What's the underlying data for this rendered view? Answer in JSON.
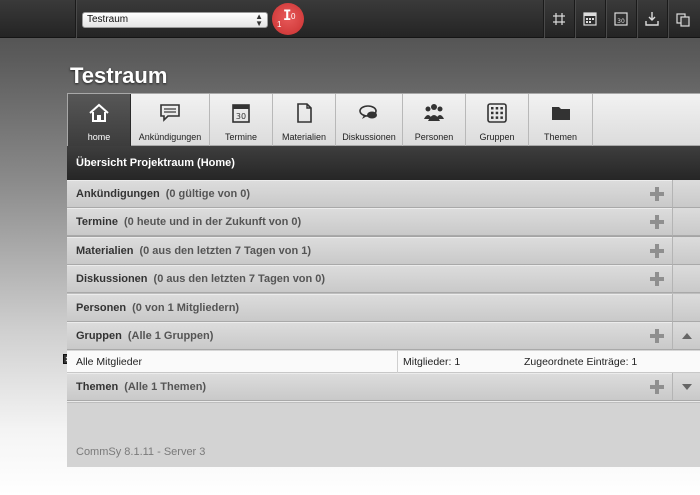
{
  "topbar": {
    "room_select_value": "Testraum",
    "icons": [
      "grid-icon",
      "calendar-list-icon",
      "calendar-30-icon",
      "download-icon",
      "copy-icon"
    ]
  },
  "room": {
    "title": "Testraum"
  },
  "tabs": [
    {
      "label": "home",
      "icon": "home-icon",
      "active": true
    },
    {
      "label": "Ankündigungen",
      "icon": "announcement-icon"
    },
    {
      "label": "Termine",
      "icon": "calendar-icon"
    },
    {
      "label": "Materialien",
      "icon": "document-icon"
    },
    {
      "label": "Diskussionen",
      "icon": "discussion-icon"
    },
    {
      "label": "Personen",
      "icon": "people-icon"
    },
    {
      "label": "Gruppen",
      "icon": "groups-icon"
    },
    {
      "label": "Themen",
      "icon": "folder-icon"
    }
  ],
  "overview": {
    "title": "Übersicht Projektraum (Home)"
  },
  "sections": [
    {
      "name": "Ankündigungen",
      "info": "(0 gültige von 0)"
    },
    {
      "name": "Termine",
      "info": "(0 heute und in der Zukunft von 0)"
    },
    {
      "name": "Materialien",
      "info": "(0 aus den letzten 7 Tagen von 1)"
    },
    {
      "name": "Diskussionen",
      "info": "(0 aus den letzten 7 Tagen von 0)"
    },
    {
      "name": "Personen",
      "info": "(0 von 1 Mitgliedern)"
    },
    {
      "name": "Gruppen",
      "info": "(Alle 1 Gruppen)"
    },
    {
      "name": "Themen",
      "info": "(Alle 1 Themen)"
    }
  ],
  "group_item": {
    "name": "Alle Mitglieder",
    "members": "Mitglieder: 1",
    "entries": "Zugeordnete Einträge: 1"
  },
  "cursor_badge": {
    "left_digit": "1",
    "right_digit": "0"
  },
  "footer": {
    "version": "CommSy 8.1.11 - Server 3"
  },
  "colors": {
    "active_tab": "#4a4a4a",
    "header_bg": "#2e2e2e",
    "cursor_badge": "#d94040"
  }
}
